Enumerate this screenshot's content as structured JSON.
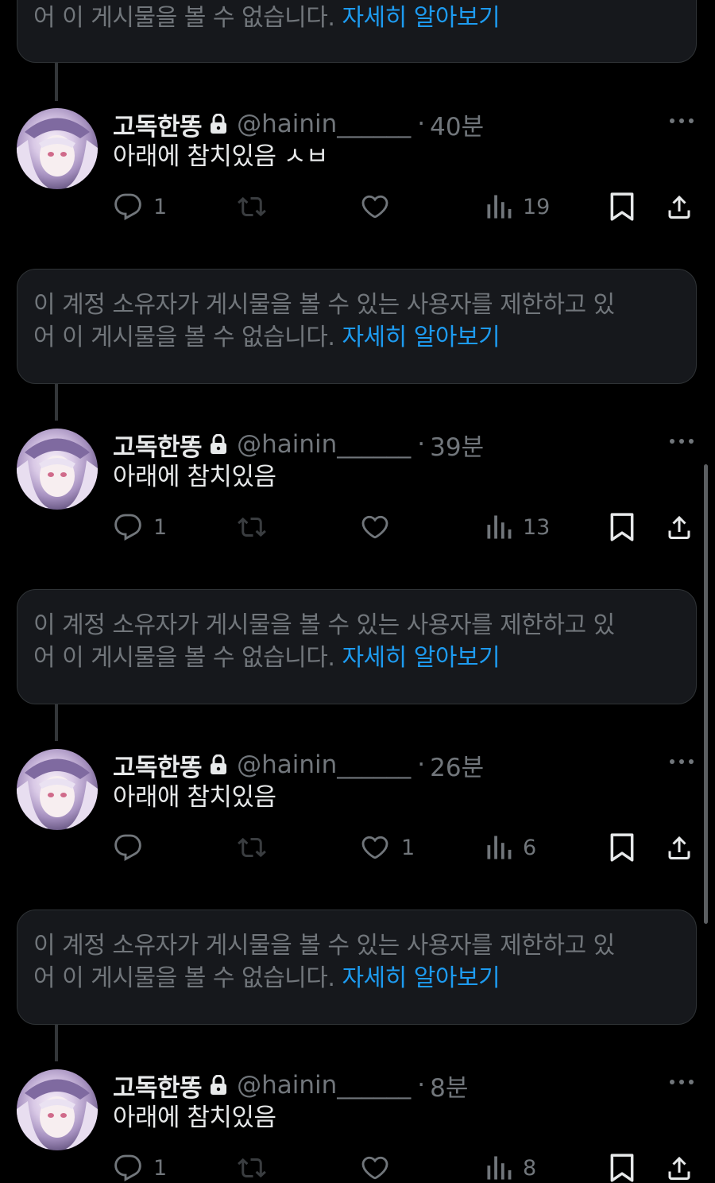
{
  "notice": {
    "line1": "이 계정 소유자가 게시물을 볼 수 있는 사용자를 제한하고 있",
    "line2": "어 이 게시물을 볼 수 없습니다. ",
    "link": "자세히 알아보기"
  },
  "tweets": [
    {
      "name": "고독한똥",
      "handle": "@hainin______",
      "time": "40분",
      "text": "아래에 참치있음 ㅅㅂ",
      "replies": "1",
      "retweets": "",
      "likes": "",
      "views": "19"
    },
    {
      "name": "고독한똥",
      "handle": "@hainin______",
      "time": "39분",
      "text": "아래에 참치있음",
      "replies": "1",
      "retweets": "",
      "likes": "",
      "views": "13"
    },
    {
      "name": "고독한똥",
      "handle": "@hainin______",
      "time": "26분",
      "text": "아래애 참치있음",
      "replies": "",
      "retweets": "",
      "likes": "1",
      "views": "6"
    },
    {
      "name": "고독한똥",
      "handle": "@hainin______",
      "time": "8분",
      "text": "아래에 참치있음",
      "replies": "1",
      "retweets": "",
      "likes": "",
      "views": "8"
    }
  ],
  "icons": {
    "reply": "reply-icon",
    "retweet": "retweet-icon",
    "like": "heart-icon",
    "views": "views-icon",
    "bookmark": "bookmark-icon",
    "share": "share-icon",
    "lock": "lock-icon",
    "more": "more-icon"
  },
  "colors": {
    "background": "#000000",
    "notice_bg": "#16181c",
    "link": "#1d9bf0",
    "secondary_text": "#71767b",
    "primary_text": "#e7e9ea"
  }
}
